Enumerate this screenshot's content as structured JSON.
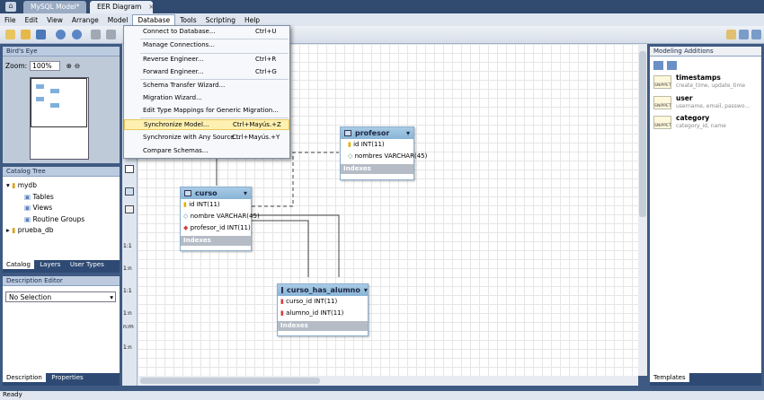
{
  "tabs": [
    {
      "label": "MySQL Model*"
    },
    {
      "label": "EER Diagram"
    }
  ],
  "menubar": [
    "File",
    "Edit",
    "View",
    "Arrange",
    "Model",
    "Database",
    "Tools",
    "Scripting",
    "Help"
  ],
  "database_menu": {
    "items": [
      {
        "label": "Connect to Database...",
        "shortcut": "Ctrl+U"
      },
      {
        "label": "Manage Connections...",
        "shortcut": ""
      },
      {
        "label": "Reverse Engineer...",
        "shortcut": "Ctrl+R"
      },
      {
        "label": "Forward Engineer...",
        "shortcut": "Ctrl+G"
      },
      {
        "label": "Schema Transfer Wizard...",
        "shortcut": ""
      },
      {
        "label": "Migration Wizard...",
        "shortcut": ""
      },
      {
        "label": "Edit Type Mappings for Generic Migration...",
        "shortcut": ""
      },
      {
        "label": "Synchronize Model...",
        "shortcut": "Ctrl+Mayús.+Z"
      },
      {
        "label": "Synchronize with Any Source...",
        "shortcut": "Ctrl+Mayús.+Y"
      },
      {
        "label": "Compare Schemas...",
        "shortcut": ""
      }
    ]
  },
  "birds_eye": {
    "title": "Bird's Eye",
    "zoom_label": "Zoom:",
    "zoom_value": "100%"
  },
  "catalog": {
    "title": "Catalog Tree",
    "schema": "mydb",
    "children": [
      "Tables",
      "Views",
      "Routine Groups"
    ],
    "other_schema": "prueba_db",
    "tabs": [
      "Catalog",
      "Layers",
      "User Types"
    ]
  },
  "description": {
    "title": "Description Editor",
    "select": "No Selection",
    "tabs": [
      "Description",
      "Properties"
    ]
  },
  "modeling": {
    "title": "Modeling Additions",
    "items": [
      {
        "name": "timestamps",
        "detail": "create_time, update_time"
      },
      {
        "name": "user",
        "detail": "username, email, passwo..."
      },
      {
        "name": "category",
        "detail": "category_id, name"
      }
    ],
    "badge": "SNIPPET",
    "tab": "Templates"
  },
  "tables": {
    "profesor": {
      "name": "profesor",
      "cols": [
        "id INT(11)",
        "nombres VARCHAR(45)"
      ],
      "indexes": "Indexes"
    },
    "curso": {
      "name": "curso",
      "cols": [
        "id INT(11)",
        "nombre VARCHAR(45)",
        "profesor_id INT(11)"
      ],
      "indexes": "Indexes"
    },
    "cha": {
      "name": "curso_has_alumno",
      "cols": [
        "curso_id INT(11)",
        "alumno_id INT(11)"
      ],
      "indexes": "Indexes"
    }
  },
  "vtool_labels": [
    "1:1",
    "1:n",
    "1:1",
    "1:n",
    "n:m",
    "1:n"
  ],
  "status": "Ready"
}
